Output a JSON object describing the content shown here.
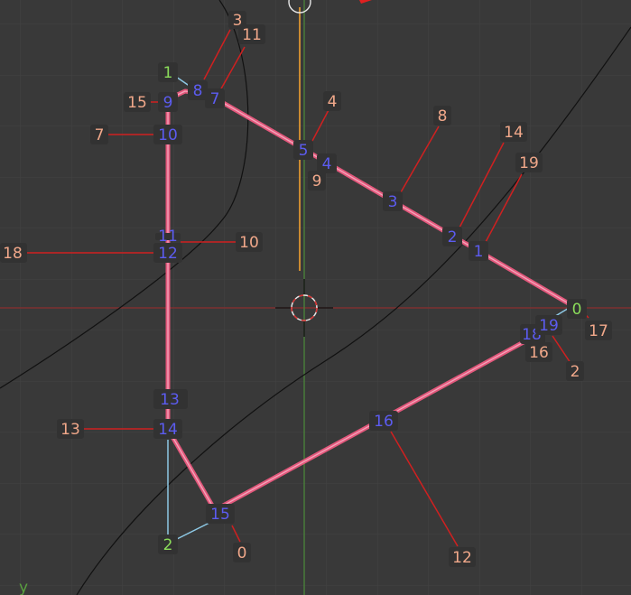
{
  "colors": {
    "background": "#393939",
    "grid": "#424242",
    "x_axis": "#8a2e2e",
    "y_axis": "#4c8a3a",
    "edge": "#e3587c",
    "edge_core": "#f4a6bb",
    "leader": "#d02020",
    "vertex_index": "#5c5cf0",
    "edge_index": "#f1a88a",
    "selected_vertex": "#8bdc5a",
    "cyan_edge": "#8ec9e6",
    "orange_line": "#f0a030",
    "curve": "#111111"
  },
  "axis_label": "y",
  "vertex_labels": [
    "0",
    "1",
    "2",
    "3",
    "4",
    "5",
    "7",
    "8",
    "9",
    "10",
    "11",
    "12",
    "13",
    "14",
    "15",
    "16",
    "18",
    "19"
  ],
  "edge_labels": [
    "3",
    "11",
    "4",
    "8",
    "14",
    "19",
    "15",
    "7",
    "9",
    "10",
    "18",
    "17",
    "16",
    "2",
    "13",
    "0",
    "12"
  ],
  "green_labels": [
    "1",
    "0",
    "2"
  ],
  "icons": {
    "cursor": "3d-cursor-icon",
    "gizmo": "origin-gizmo-icon"
  }
}
